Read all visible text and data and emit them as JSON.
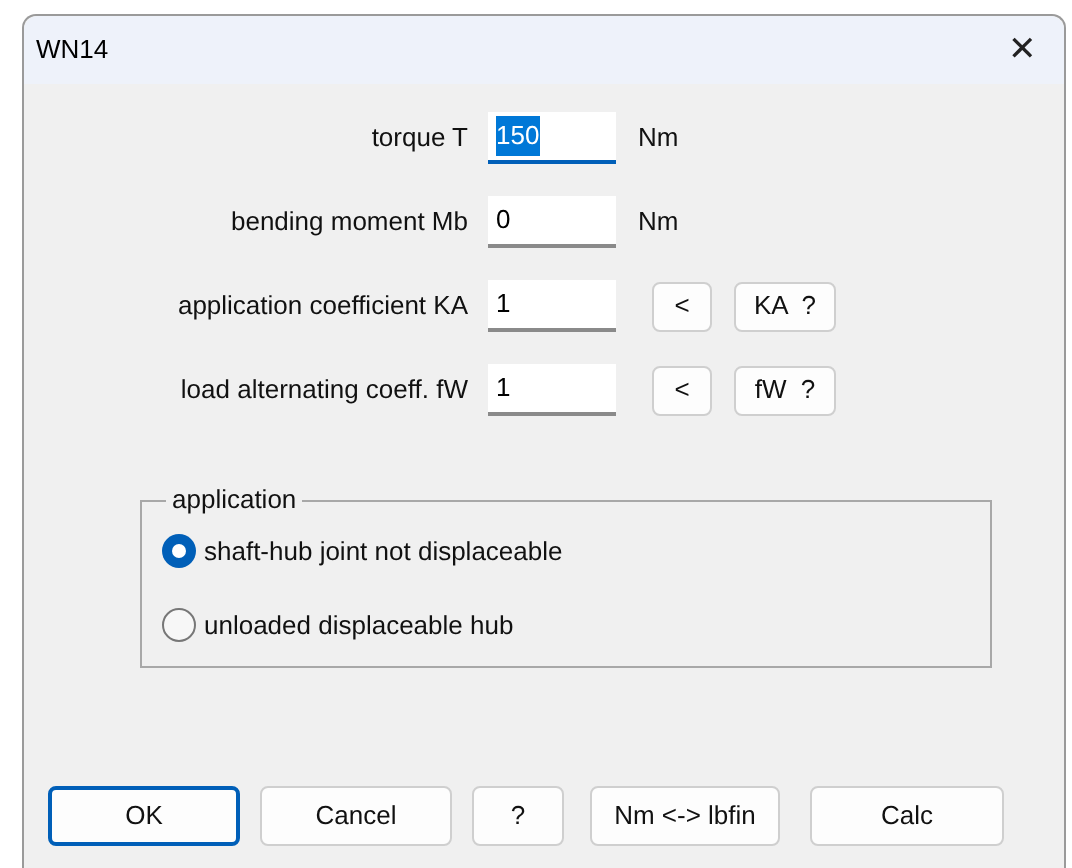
{
  "window": {
    "title": "WN14",
    "close": "✕"
  },
  "fields": [
    {
      "label": "torque T",
      "value": "150",
      "focused": true,
      "unit": "Nm"
    },
    {
      "label": "bending moment Mb",
      "value": "0",
      "focused": false,
      "unit": "Nm"
    },
    {
      "label": "application coefficient KA",
      "value": "1",
      "focused": false,
      "buttons": [
        "<",
        "KA  ?"
      ]
    },
    {
      "label": "load alternating coeff. fW",
      "value": "1",
      "focused": false,
      "buttons": [
        "<",
        "fW  ?"
      ]
    }
  ],
  "group": {
    "title": "application",
    "options": [
      {
        "label": "shaft-hub joint not displaceable",
        "selected": true
      },
      {
        "label": "unloaded displaceable hub",
        "selected": false
      }
    ]
  },
  "buttons": [
    {
      "label": "OK",
      "default": true
    },
    {
      "label": "Cancel",
      "default": false
    },
    {
      "label": "?",
      "default": false
    },
    {
      "label": "Nm <-> lbfin",
      "default": false
    },
    {
      "label": "Calc",
      "default": false
    }
  ]
}
